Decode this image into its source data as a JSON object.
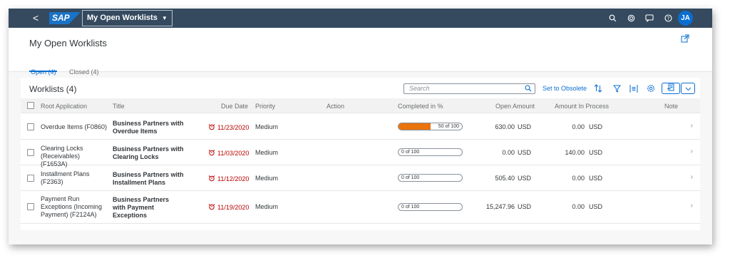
{
  "shell": {
    "back": "<",
    "logo": "SAP",
    "app_title": "My Open Worklists",
    "avatar": "JA",
    "icons": [
      "search-icon",
      "copilot-icon",
      "feedback-icon",
      "help-icon",
      "notification-icon"
    ]
  },
  "page": {
    "title": "My Open Worklists",
    "tabs": [
      {
        "label": "Open (4)",
        "selected": true
      },
      {
        "label": "Closed (4)",
        "selected": false
      }
    ]
  },
  "table": {
    "heading": "Worklists (4)",
    "search_placeholder": "Search",
    "toolbar": {
      "set_obsolete": "Set to Obsolete",
      "icons": [
        "sort-icon",
        "filter-icon",
        "group-icon",
        "settings-icon",
        "export-icon",
        "dropdown-icon"
      ]
    },
    "columns": {
      "root_application": "Root Application",
      "title": "Title",
      "due_date": "Due Date",
      "priority": "Priority",
      "action": "Action",
      "completed": "Completed in %",
      "open_amount": "Open Amount",
      "amount_in_process": "Amount In Process",
      "note": "Note"
    },
    "rows": [
      {
        "root": "Overdue Items (F0860)",
        "title": "Business Partners with Overdue Items",
        "due": "11/23/2020",
        "priority": "Medium",
        "progress_label": "50 of 100",
        "progress_fraction": 0.5,
        "open_amount": "630.00",
        "open_currency": "USD",
        "in_process": "0.00",
        "in_process_currency": "USD"
      },
      {
        "root": "Clearing Locks (Receivables) (F1653A)",
        "title": "Business Partners with Clearing Locks",
        "due": "11/03/2020",
        "priority": "Medium",
        "progress_label": "0 of 100",
        "progress_fraction": 0,
        "open_amount": "0.00",
        "open_currency": "USD",
        "in_process": "140.00",
        "in_process_currency": "USD"
      },
      {
        "root": "Installment Plans (F2363)",
        "title": "Business Partners with Installment Plans",
        "due": "11/12/2020",
        "priority": "Medium",
        "progress_label": "0 of 100",
        "progress_fraction": 0,
        "open_amount": "505.40",
        "open_currency": "USD",
        "in_process": "0.00",
        "in_process_currency": "USD"
      },
      {
        "root": "Payment Run Exceptions (Incoming Payment) (F2124A)",
        "title": "Business Partners with Payment Exceptions",
        "due": "11/19/2020",
        "priority": "Medium",
        "progress_label": "0 of 100",
        "progress_fraction": 0,
        "open_amount": "15,247.96",
        "open_currency": "USD",
        "in_process": "0.00",
        "in_process_currency": "USD"
      }
    ]
  },
  "colors": {
    "shell": "#354a5f",
    "accent": "#0a6ed1",
    "overdue": "#bb0000",
    "progress": "#e9730c"
  }
}
